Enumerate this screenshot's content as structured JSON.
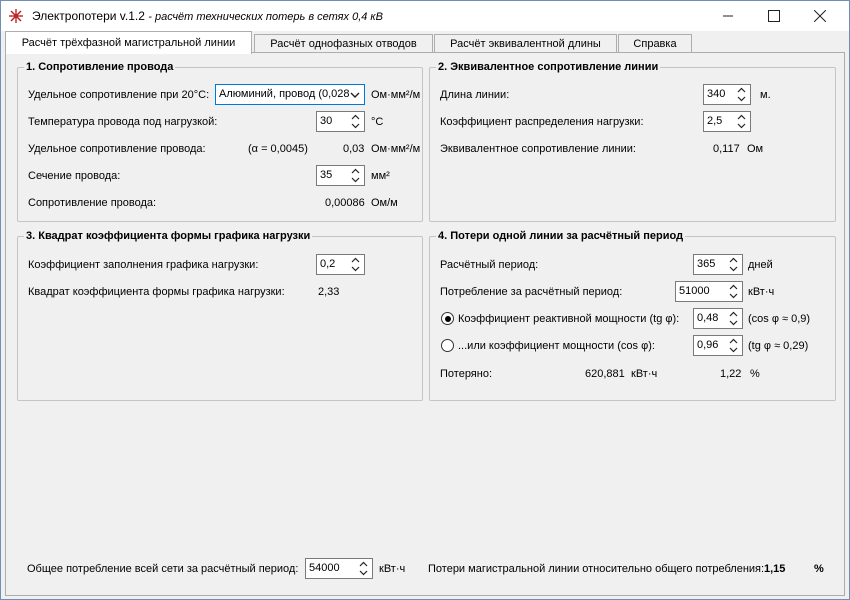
{
  "window": {
    "title": "Электропотери v.1.2",
    "subtitle": "- расчёт технических потерь в сетях 0,4 кВ",
    "minimize_glyph": "—",
    "maximize_glyph": "☐",
    "close_glyph": "✕"
  },
  "tabs": [
    {
      "label": "Расчёт трёхфазной магистральной линии",
      "active": true
    },
    {
      "label": "Расчёт однофазных отводов",
      "active": false
    },
    {
      "label": "Расчёт эквивалентной длины",
      "active": false
    },
    {
      "label": "Справка",
      "active": false
    }
  ],
  "group1": {
    "title": "1. Сопротивление провода",
    "resistivity20_label": "Удельное сопротивление при 20°С:",
    "material_value": "Алюминий, провод (0,028",
    "resistivity20_unit": "Ом·мм²/м",
    "temperature_label": "Температура провода под нагрузкой:",
    "temperature_value": "30",
    "temperature_unit": "°С",
    "resistivity_label": "Удельное сопротивление провода:",
    "alpha_text": "(α = 0,0045)",
    "resistivity_value": "0,03",
    "resistivity_unit": "Ом·мм²/м",
    "section_label": "Сечение провода:",
    "section_value": "35",
    "section_unit": "мм²",
    "resistance_label": "Сопротивление провода:",
    "resistance_value": "0,00086",
    "resistance_unit": "Ом/м"
  },
  "group2": {
    "title": "2. Эквивалентное сопротивление линии",
    "length_label": "Длина линии:",
    "length_value": "340",
    "length_unit": "м.",
    "distribution_label": "Коэффициент распределения нагрузки:",
    "distribution_value": "2,5",
    "eq_resistance_label": "Эквивалентное сопротивление линии:",
    "eq_resistance_value": "0,117",
    "eq_resistance_unit": "Ом"
  },
  "group3": {
    "title": "3. Квадрат коэффициента формы графика нагрузки",
    "fill_factor_label": "Коэффициент заполнения графика нагрузки:",
    "fill_factor_value": "0,2",
    "form_factor_label": "Квадрат коэффициента формы графика нагрузки:",
    "form_factor_value": "2,33"
  },
  "group4": {
    "title": "4. Потери одной линии за расчётный период",
    "period_label": "Расчётный период:",
    "period_value": "365",
    "period_unit": "дней",
    "consumption_label": "Потребление за расчётный период:",
    "consumption_value": "51000",
    "consumption_unit": "кВт·ч",
    "reactive_label": "Коэффициент реактивной мощности (tg φ):",
    "reactive_value": "0,48",
    "reactive_hint": "(cos φ ≈ 0,9)",
    "reactive_selected": true,
    "power_factor_label": "...или коэффициент мощности (cos φ):",
    "power_factor_value": "0,96",
    "power_factor_hint": "(tg φ ≈ 0,29)",
    "lost_label": "Потеряно:",
    "lost_value": "620,881",
    "lost_unit": "кВт·ч",
    "lost_percent": "1,22",
    "lost_percent_unit": "%"
  },
  "footer": {
    "total_label": "Общее потребление всей сети за расчётный период:",
    "total_value": "54000",
    "total_unit": "кВт·ч",
    "ratio_label": "Потери магистральной линии относительно общего потребления:",
    "ratio_value": "1,15",
    "ratio_unit": "%"
  }
}
